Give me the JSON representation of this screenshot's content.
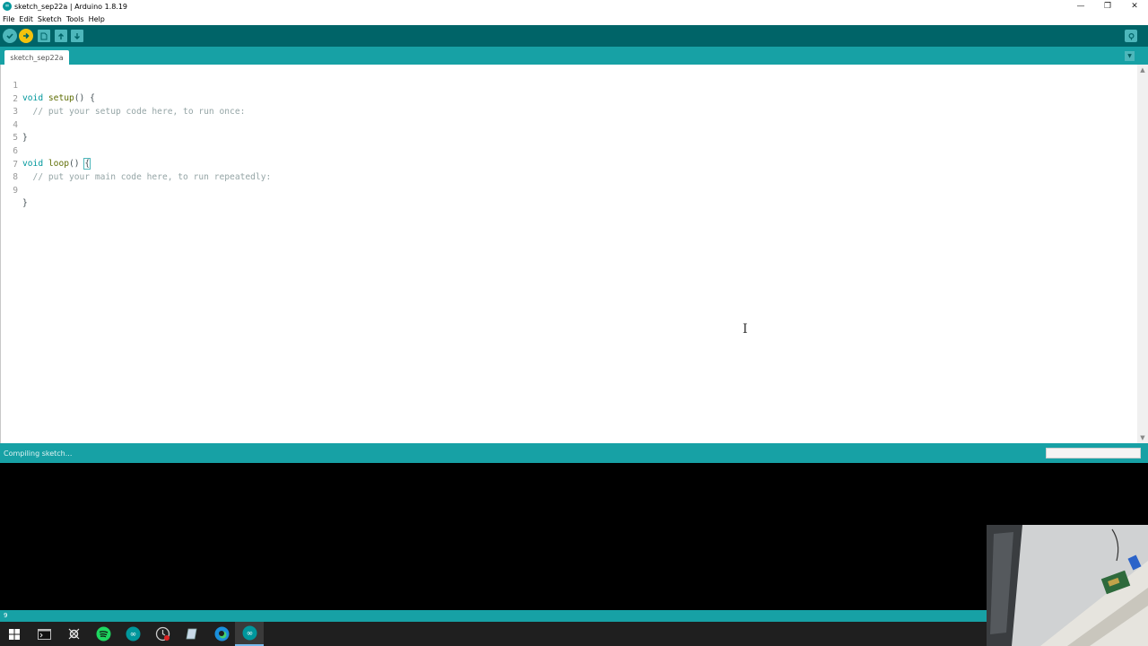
{
  "window": {
    "title": "sketch_sep22a | Arduino 1.8.19",
    "minimize_glyph": "—",
    "maximize_glyph": "❐",
    "close_glyph": "✕"
  },
  "menu": {
    "items": [
      "File",
      "Edit",
      "Sketch",
      "Tools",
      "Help"
    ]
  },
  "toolbar": {
    "buttons": [
      {
        "name": "verify",
        "icon": "check-icon"
      },
      {
        "name": "upload",
        "icon": "arrow-right-icon"
      },
      {
        "name": "new",
        "icon": "new-file-icon"
      },
      {
        "name": "open",
        "icon": "arrow-up-icon"
      },
      {
        "name": "save",
        "icon": "arrow-down-icon"
      }
    ],
    "serial_monitor_icon": "magnifier-icon"
  },
  "tabs": {
    "active_label": "sketch_sep22a",
    "menu_glyph": "▼"
  },
  "editor": {
    "lines": [
      {
        "n": "1",
        "text": "void setup() {"
      },
      {
        "n": "2",
        "text": "  // put your setup code here, to run once:"
      },
      {
        "n": "3",
        "text": ""
      },
      {
        "n": "4",
        "text": "}"
      },
      {
        "n": "5",
        "text": ""
      },
      {
        "n": "6",
        "text": "void loop() {"
      },
      {
        "n": "7",
        "text": "  // put your main code here, to run repeatedly:"
      },
      {
        "n": "8",
        "text": ""
      },
      {
        "n": "9",
        "text": "}"
      }
    ],
    "cursor_glyph": "I"
  },
  "status": {
    "message": "Compiling sketch...",
    "progress_percent": 0
  },
  "footer": {
    "line_number": "9"
  },
  "taskbar": {
    "apps": [
      "windows-start-icon",
      "terminal-icon",
      "tool-icon",
      "spotify-icon",
      "arduino-icon",
      "recorder-icon",
      "notes-icon",
      "edge-icon",
      "arduino-active-icon"
    ]
  },
  "colors": {
    "toolbar": "#006468",
    "tabbar": "#17a1a5",
    "upload_active": "#f4c20d",
    "keyword": "#00979c",
    "function": "#5e6d03",
    "comment": "#95a5a6"
  }
}
